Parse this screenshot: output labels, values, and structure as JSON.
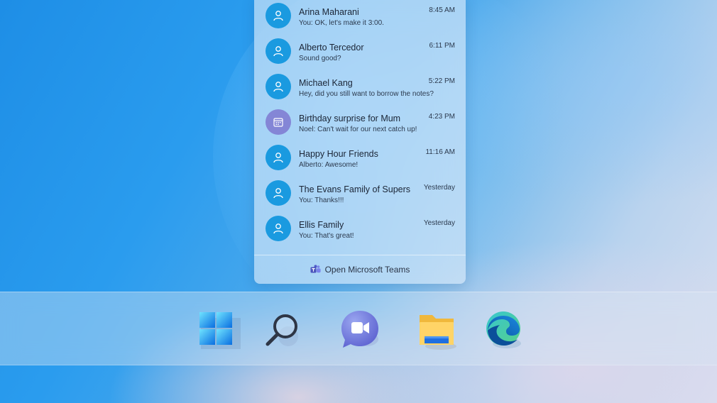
{
  "chat": {
    "items": [
      {
        "name": "Arina Maharani",
        "preview": "You: OK, let's make it 3:00.",
        "time": "8:45 AM",
        "avatar": "person-icon"
      },
      {
        "name": "Alberto Tercedor",
        "preview": "Sound good?",
        "time": "6:11 PM",
        "avatar": "person-icon"
      },
      {
        "name": "Michael Kang",
        "preview": "Hey, did you still want to borrow the notes?",
        "time": "5:22 PM",
        "avatar": "person-icon"
      },
      {
        "name": "Birthday surprise for Mum",
        "preview": "Noel: Can't wait for our next catch up!",
        "time": "4:23 PM",
        "avatar": "calendar-icon"
      },
      {
        "name": "Happy Hour Friends",
        "preview": "Alberto: Awesome!",
        "time": "11:16 AM",
        "avatar": "person-icon"
      },
      {
        "name": "The Evans Family of Supers",
        "preview": "You: Thanks!!!",
        "time": "Yesterday",
        "avatar": "person-icon"
      },
      {
        "name": "Ellis Family",
        "preview": "You: That's great!",
        "time": "Yesterday",
        "avatar": "person-icon"
      }
    ],
    "footer_label": "Open Microsoft Teams"
  },
  "taskbar": {
    "icons": [
      "windows-start-icon",
      "search-icon",
      "chat-video-icon",
      "file-explorer-icon",
      "edge-browser-icon"
    ]
  },
  "colors": {
    "avatar_blue": "#1a9ae0",
    "avatar_purple": "#8486d6"
  }
}
